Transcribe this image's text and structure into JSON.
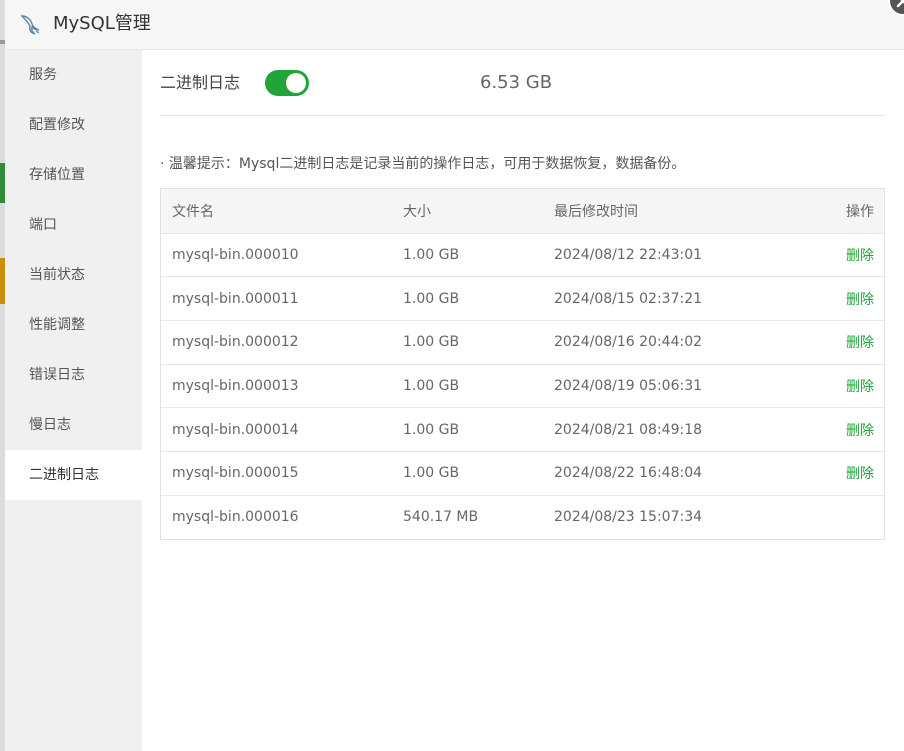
{
  "title": "MySQL管理",
  "sidebar": {
    "items": [
      {
        "label": "服务"
      },
      {
        "label": "配置修改"
      },
      {
        "label": "存储位置"
      },
      {
        "label": "端口"
      },
      {
        "label": "当前状态"
      },
      {
        "label": "性能调整"
      },
      {
        "label": "错误日志"
      },
      {
        "label": "慢日志"
      },
      {
        "label": "二进制日志",
        "active": true
      }
    ]
  },
  "binlog": {
    "label": "二进制日志",
    "enabled": true,
    "total_size": "6.53 GB",
    "tip": "· 温馨提示：Mysql二进制日志是记录当前的操作日志，可用于数据恢复，数据备份。"
  },
  "table": {
    "headers": {
      "file": "文件名",
      "size": "大小",
      "time": "最后修改时间",
      "op": "操作"
    },
    "rows": [
      {
        "file": "mysql-bin.000010",
        "size": "1.00 GB",
        "time": "2024/08/12 22:43:01",
        "op": "删除"
      },
      {
        "file": "mysql-bin.000011",
        "size": "1.00 GB",
        "time": "2024/08/15 02:37:21",
        "op": "删除"
      },
      {
        "file": "mysql-bin.000012",
        "size": "1.00 GB",
        "time": "2024/08/16 20:44:02",
        "op": "删除"
      },
      {
        "file": "mysql-bin.000013",
        "size": "1.00 GB",
        "time": "2024/08/19 05:06:31",
        "op": "删除"
      },
      {
        "file": "mysql-bin.000014",
        "size": "1.00 GB",
        "time": "2024/08/21 08:49:18",
        "op": "删除"
      },
      {
        "file": "mysql-bin.000015",
        "size": "1.00 GB",
        "time": "2024/08/22 16:48:04",
        "op": "删除"
      },
      {
        "file": "mysql-bin.000016",
        "size": "540.17 MB",
        "time": "2024/08/23 15:07:34",
        "op": ""
      }
    ]
  },
  "colors": {
    "accent": "#20a53a"
  }
}
